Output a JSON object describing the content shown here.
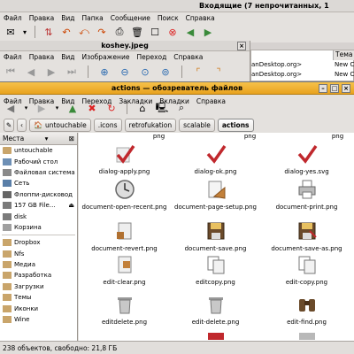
{
  "back_window": {
    "title": "Входящие (7 непрочитанных, 1",
    "menu": [
      "Файл",
      "Правка",
      "Вид",
      "Папка",
      "Сообщение",
      "Поиск",
      "Справка"
    ],
    "column_header": "Тема",
    "rows": [
      {
        "from": "anDesktop.org>",
        "subject": "New C"
      },
      {
        "from": "anDesktop.org>",
        "subject": "New C"
      }
    ]
  },
  "image_window": {
    "title": "koshey.jpeg",
    "menu": [
      "Файл",
      "Правка",
      "Вид",
      "Изображение",
      "Переход",
      "Справка"
    ]
  },
  "file_manager": {
    "title": "actions — обозреватель файлов",
    "menu": [
      "Файл",
      "Правка",
      "Вид",
      "Переход",
      "Закладки",
      "Вкладки",
      "Справка"
    ],
    "path": [
      "untouchable",
      ".icons",
      "retrofukation",
      "scalable",
      "actions"
    ],
    "sidebar_title": "Места",
    "places": [
      {
        "label": "untouchable",
        "icon": "home-folder-icon"
      },
      {
        "label": "Рабочий стол",
        "icon": "desktop-icon"
      },
      {
        "label": "Файловая система",
        "icon": "harddisk-icon"
      },
      {
        "label": "Сеть",
        "icon": "network-icon"
      },
      {
        "label": "Флоппи-дисковод",
        "icon": "floppy-icon"
      },
      {
        "label": "157 GB File…",
        "icon": "drive-icon"
      },
      {
        "label": "disk",
        "icon": "drive-icon"
      },
      {
        "label": "Корзина",
        "icon": "trash-icon"
      }
    ],
    "bookmarks": [
      {
        "label": "Dropbox"
      },
      {
        "label": "Nfs"
      },
      {
        "label": "Медиа"
      },
      {
        "label": "Разработка"
      },
      {
        "label": "Загрузки"
      },
      {
        "label": "Темы"
      },
      {
        "label": "Иконки"
      },
      {
        "label": "Wine"
      }
    ],
    "files": [
      {
        "name": "png",
        "icon": "partial-icon"
      },
      {
        "name": "png",
        "icon": "partial-icon"
      },
      {
        "name": "png",
        "icon": "partial-icon"
      },
      {
        "name": "dialog-apply.png",
        "icon": "checkmark-icon"
      },
      {
        "name": "dialog-ok.png",
        "icon": "checkmark-icon"
      },
      {
        "name": "dialog-yes.svg",
        "icon": "checkmark-icon"
      },
      {
        "name": "document-open-recent.png",
        "icon": "clock-icon"
      },
      {
        "name": "document-page-setup.png",
        "icon": "page-setup-icon"
      },
      {
        "name": "document-print.png",
        "icon": "printer-icon"
      },
      {
        "name": "document-revert.png",
        "icon": "revert-icon"
      },
      {
        "name": "document-save.png",
        "icon": "floppy-save-icon"
      },
      {
        "name": "document-save-as.png",
        "icon": "floppy-save-icon"
      },
      {
        "name": "edit-clear.png",
        "icon": "clear-icon"
      },
      {
        "name": "editcopy.png",
        "icon": "copy-icon"
      },
      {
        "name": "edit-copy.png",
        "icon": "copy-icon"
      },
      {
        "name": "editdelete.png",
        "icon": "bin-icon"
      },
      {
        "name": "edit-delete.png",
        "icon": "bin-icon"
      },
      {
        "name": "edit-find.png",
        "icon": "binoculars-icon"
      }
    ],
    "status": "238 объектов, свободно: 21,8 ГБ"
  }
}
